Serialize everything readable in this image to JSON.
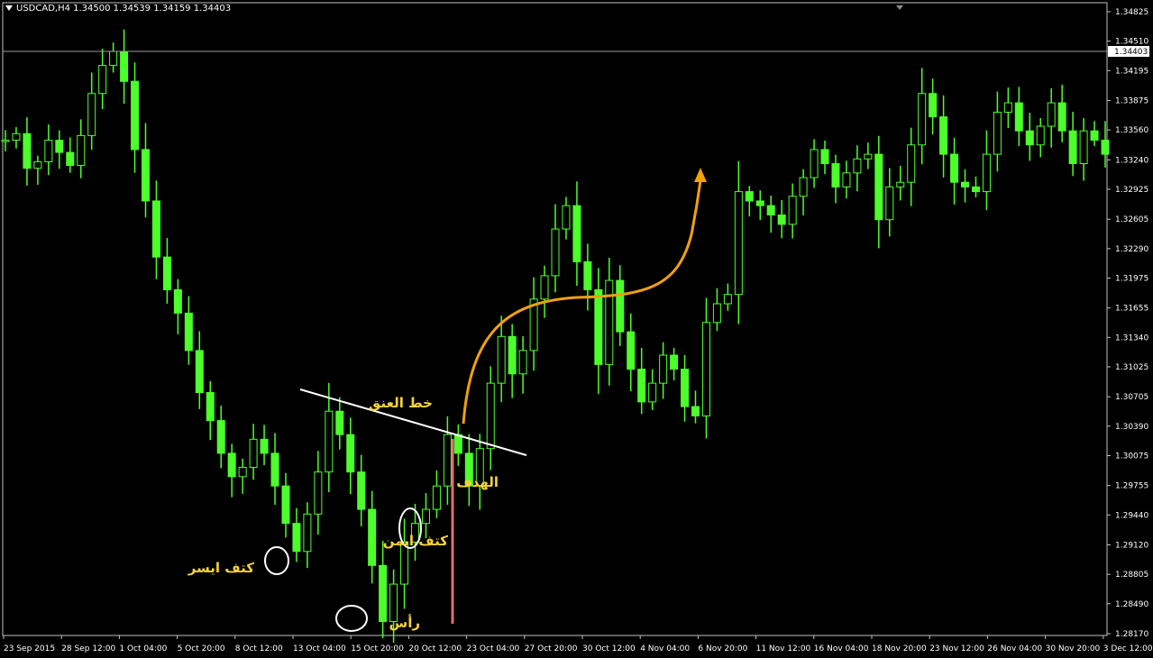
{
  "header": {
    "symbol_line": "USDCAD,H4  1.34500 1.34539 1.34159 1.34403"
  },
  "current_price": "1.34403",
  "annotations": {
    "neckline": "خط العنق",
    "left_shoulder": "كتف ايسر",
    "head": "رأس",
    "right_shoulder": "كتف ايمن",
    "target": "الهدف"
  },
  "colors": {
    "background": "#000000",
    "candles": "#4cff2a",
    "neckline": "#ffffff",
    "arrow": "#f0a010",
    "target_line": "#e07070",
    "annotation_text": "#f5d13a",
    "axis": "#c0c0c0"
  },
  "chart_data": {
    "type": "line",
    "title": "USDCAD,H4",
    "ylim": [
      1.2817,
      1.34825
    ],
    "y_ticks": [
      "1.34825",
      "1.34510",
      "1.34195",
      "1.33875",
      "1.33560",
      "1.33240",
      "1.32925",
      "1.32605",
      "1.32290",
      "1.31975",
      "1.31655",
      "1.31340",
      "1.31025",
      "1.30705",
      "1.30390",
      "1.30075",
      "1.29755",
      "1.29440",
      "1.29120",
      "1.28805",
      "1.28490",
      "1.28170"
    ],
    "x_ticks": [
      "23 Sep 2015",
      "28 Sep 12:00",
      "1 Oct 04:00",
      "5 Oct 20:00",
      "8 Oct 12:00",
      "13 Oct 04:00",
      "15 Oct 20:00",
      "20 Oct 12:00",
      "23 Oct 04:00",
      "27 Oct 20:00",
      "30 Oct 12:00",
      "4 Nov 04:00",
      "6 Nov 20:00",
      "11 Nov 12:00",
      "16 Nov 04:00",
      "18 Nov 20:00",
      "23 Nov 12:00",
      "26 Nov 04:00",
      "30 Nov 20:00",
      "3 Dec 12:00"
    ],
    "series": [
      {
        "values": [
          1.3345,
          1.3352,
          1.3315,
          1.3322,
          1.3345,
          1.3332,
          1.3318,
          1.335,
          1.3395,
          1.3425,
          1.344,
          1.3408,
          1.3335,
          1.328,
          1.322,
          1.3185,
          1.316,
          1.312,
          1.3075,
          1.3045,
          1.301,
          1.2985,
          1.2995,
          1.3025,
          1.301,
          1.2975,
          1.2935,
          1.2905,
          1.2945,
          1.299,
          1.3055,
          1.303,
          1.299,
          1.295,
          1.289,
          1.283,
          1.287,
          1.2915,
          1.2935,
          1.295,
          1.2975,
          1.303,
          1.301,
          1.2975,
          1.3015,
          1.3085,
          1.3135,
          1.3095,
          1.312,
          1.3175,
          1.32,
          1.325,
          1.3275,
          1.3215,
          1.3185,
          1.3105,
          1.3195,
          1.314,
          1.31,
          1.3065,
          1.3085,
          1.3115,
          1.31,
          1.306,
          1.305,
          1.315,
          1.317,
          1.318,
          1.329,
          1.328,
          1.3275,
          1.3265,
          1.3255,
          1.3285,
          1.3305,
          1.3335,
          1.332,
          1.3295,
          1.331,
          1.3325,
          1.333,
          1.326,
          1.3295,
          1.33,
          1.334,
          1.3395,
          1.337,
          1.333,
          1.33,
          1.3295,
          1.329,
          1.333,
          1.3375,
          1.3385,
          1.3355,
          1.334,
          1.336,
          1.3385,
          1.3355,
          1.332,
          1.3355,
          1.3345,
          1.333
        ]
      }
    ]
  }
}
